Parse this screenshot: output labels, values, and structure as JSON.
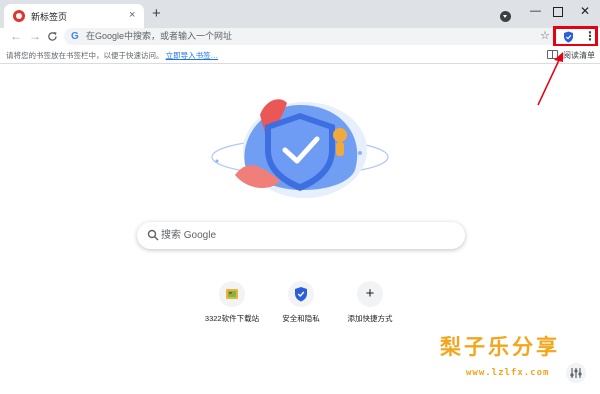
{
  "tab": {
    "title": "新标签页",
    "close": "×"
  },
  "new_tab": "+",
  "window": {
    "minimize": "—",
    "close": "✕"
  },
  "toolbar": {
    "back": "←",
    "forward": "→",
    "reload": "C",
    "omnibox_logo": "G",
    "omnibox_placeholder": "在Google中搜索，或者输入一个网址",
    "star": "☆",
    "menu": "⋮"
  },
  "bookmarks": {
    "prompt": "请将您的书签放在书签栏中，以便于快速访问。",
    "import_link": "立即导入书签…",
    "reading_list": "阅读清单"
  },
  "search": {
    "placeholder": "搜索 Google"
  },
  "shortcuts": [
    {
      "label": "3322软件下载站",
      "icon": "3322-site-icon"
    },
    {
      "label": "安全和隐私",
      "icon": "shield-check-icon"
    },
    {
      "label": "添加快捷方式",
      "icon": "plus-icon",
      "symbol": "+"
    }
  ],
  "watermark": {
    "text": "梨子乐分享",
    "url": "www.lzlfx.com"
  },
  "colors": {
    "highlight": "#e60012",
    "accent": "#1a73e8",
    "watermark": "#f4a51c"
  }
}
